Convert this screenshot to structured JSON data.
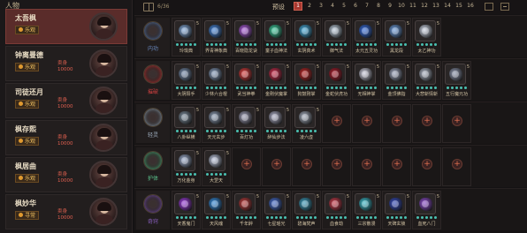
{
  "left_panel": {
    "title": "人物",
    "characters": [
      {
        "name": "太吾枫",
        "tag": "乐观",
        "price": "",
        "selected": true
      },
      {
        "name": "钟离曼德",
        "tag": "乐观",
        "price": "卖身\n10000"
      },
      {
        "name": "司徒还月",
        "tag": "乐观",
        "price": "卖身\n10000"
      },
      {
        "name": "枫存熙",
        "tag": "乐观",
        "price": "卖身\n10000"
      },
      {
        "name": "枫居曲",
        "tag": "乐观",
        "price": "卖身\n10000"
      },
      {
        "name": "枫妙华",
        "tag": "寻常",
        "price": "卖身\n10000"
      }
    ]
  },
  "topbar": {
    "count": "6/36",
    "preset_label": "预设",
    "pages": [
      "1",
      "2",
      "3",
      "4",
      "5",
      "6",
      "7",
      "8",
      "9",
      "10",
      "11",
      "12",
      "13",
      "14",
      "15",
      "16"
    ],
    "active_page": "1"
  },
  "colors": {
    "accent": "#a83830",
    "bead": "#4ac0b0",
    "selected_row": "#5a2c2a"
  },
  "categories": [
    {
      "label": "内功",
      "color": "#6a8ac0",
      "skills": [
        {
          "name": "玲珑典",
          "color": "#8ab0e0",
          "level": "5"
        },
        {
          "name": "界青神象典",
          "color": "#4a8ae0",
          "level": "5"
        },
        {
          "name": "百晓隐龙诀",
          "color": "#b060e0",
          "level": "5"
        },
        {
          "name": "童子血神法",
          "color": "#40d0a0",
          "level": "5"
        },
        {
          "name": "玄阴真术",
          "color": "#4ab0e0",
          "level": "5"
        },
        {
          "name": "御气法",
          "color": "#c0d0e0",
          "level": "5"
        },
        {
          "name": "太元五灵功",
          "color": "#3a70e0",
          "level": "5"
        },
        {
          "name": "黑龙段",
          "color": "#70a0e0",
          "level": "5"
        },
        {
          "name": "太乙神功",
          "color": "#d0d8e8",
          "level": "5"
        }
      ]
    },
    {
      "label": "摧破",
      "color": "#d04040",
      "skills": [
        {
          "name": "大阴阳手",
          "color": "#7a90b0",
          "level": "5"
        },
        {
          "name": "少林六合棍",
          "color": "#8aa0c0",
          "level": "5"
        },
        {
          "name": "武当神拳",
          "color": "#e04040",
          "level": "5"
        },
        {
          "name": "金刚伏魔掌",
          "color": "#d03050",
          "level": "5"
        },
        {
          "name": "狗鼓刚掌",
          "color": "#c02a2a",
          "level": "5"
        },
        {
          "name": "金蛇伏虎功",
          "color": "#b02030",
          "level": "5"
        },
        {
          "name": "无相神掌",
          "color": "#d0d0e0",
          "level": "5"
        },
        {
          "name": "金顶佛指",
          "color": "#a0a8c0",
          "level": "5"
        },
        {
          "name": "大悲斩情斩",
          "color": "#b0b8c8",
          "level": "5"
        },
        {
          "name": "五行魔元功",
          "color": "#9098b0",
          "level": "5"
        }
      ]
    },
    {
      "label": "轻灵",
      "color": "#a0b0c0",
      "skills": [
        {
          "name": "八卦纵横",
          "color": "#8090a0",
          "level": "5"
        },
        {
          "name": "天元玄步",
          "color": "#90a0b8",
          "level": "5"
        },
        {
          "name": "百灯功",
          "color": "#a0a0b8",
          "level": "5"
        },
        {
          "name": "醉仙步法",
          "color": "#b0b0c8",
          "level": "5"
        },
        {
          "name": "凌六虚",
          "color": "#a8b0c0",
          "level": "5"
        },
        {
          "name": "",
          "empty": true
        },
        {
          "name": "",
          "empty": true
        },
        {
          "name": "",
          "empty": true
        },
        {
          "name": "",
          "empty": true
        },
        {
          "name": "",
          "empty": true
        }
      ]
    },
    {
      "label": "护体",
      "color": "#5ac08a",
      "skills": [
        {
          "name": "万化金身",
          "color": "#a0b0d0",
          "level": "5"
        },
        {
          "name": "大罡天",
          "color": "#c0c8e0",
          "level": "5"
        },
        {
          "name": "",
          "empty": true
        },
        {
          "name": "",
          "empty": true
        },
        {
          "name": "",
          "empty": true
        },
        {
          "name": "",
          "empty": true
        },
        {
          "name": "",
          "empty": true
        },
        {
          "name": "",
          "empty": true
        },
        {
          "name": "",
          "empty": true
        },
        {
          "name": "",
          "empty": true
        }
      ]
    },
    {
      "label": "奇窍",
      "color": "#8a60c0",
      "skills": [
        {
          "name": "天香鬼门",
          "color": "#a040e0",
          "level": "5"
        },
        {
          "name": "天风魂",
          "color": "#3a90e0",
          "level": "5"
        },
        {
          "name": "千年醉",
          "color": "#c04040",
          "level": "5"
        },
        {
          "name": "七星瑶光",
          "color": "#4a70d0",
          "level": "5"
        },
        {
          "name": "碧海梵声",
          "color": "#40a0c0",
          "level": "5"
        },
        {
          "name": "血食劫",
          "color": "#d04050",
          "level": "5"
        },
        {
          "name": "三宗散漫",
          "color": "#40c0d0",
          "level": "5"
        },
        {
          "name": "天碑玄锁",
          "color": "#3a50c0",
          "level": "5"
        },
        {
          "name": "血死八门",
          "color": "#9050d0",
          "level": "5"
        }
      ]
    }
  ]
}
